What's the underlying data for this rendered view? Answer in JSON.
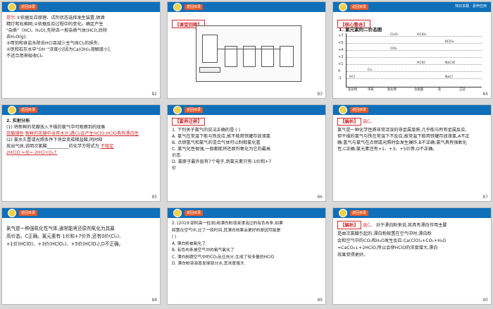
{
  "common": {
    "back_label": "返回目录",
    "tagline": "知识关联 · 素养应用"
  },
  "slides": [
    {
      "page": "82",
      "hint_label": "提示:",
      "lines": [
        "①依据反应原理、试剂状态选择发生装置,钠酒",
        "精灯和石棉网;②依据反应过程中的变化。确定产生",
        "\"杂质\"（HCl、H₂O),先除去一般杂质气体(HCl),后除",
        "去H₂O(g);",
        "③用饱和食盐水除去HCl且减少主气体Cl₂的损失;",
        "④饱和石灰水中\"OH⁻\"浓度小[因为Ca(OH)₂溶解度小],",
        "不适合用来吸收Cl₂"
      ]
    },
    {
      "page": "83",
      "box_title": "【课堂回眸】"
    },
    {
      "page": "84",
      "box_title": "【核心整合】",
      "heading": "1. 氯元素的二价态图",
      "y_ticks": [
        "+7",
        "+5",
        "+4",
        "+3",
        "+1",
        "0",
        "-1"
      ],
      "x_ticks": [
        "氢化物",
        "单质",
        "氧化物",
        "含氧酸",
        "盐",
        "正盐"
      ],
      "cells": [
        "Cl₂O₇",
        "HClO₄",
        "ClO₂",
        "KClO₃",
        "HClO",
        "NaClO",
        "Cl₂",
        "HCl",
        "NaCl"
      ]
    },
    {
      "page": "85",
      "lines": [
        "2. 实射分析",
        "(1) 将新鲜的花瓣放入干燥的氯气中可观察到的现象",
        "是__________,原因是__________",
        "(2) 氯水久置或光照条件下将会变成稀盐酸,同时释",
        "放出气体,说明次氯酸__________的化学方程式为",
        "__________"
      ],
      "answer_1": "花瓣褪色",
      "answer_2": "新鲜的花瓣中含有水分,遇Cl₂会产生HClO,HClO具有漂白性",
      "answer_3": "不稳定",
      "answer_4": "2HClO =光= 2HCl+O₂↑"
    },
    {
      "page": "86",
      "box_title": "【素养迁移】",
      "lines": [
        "1. 下列关于氯气的说法正确的是 (      )",
        "A. 氯气在常温下能与铁反应,故不能用铁罐存放液氯",
        "B. 点燃氢气和氯气的混合气体可以制取氯化氢",
        "C. 氯气化性很强,一般都能将还原剂氧化为它的最高",
        "价态",
        "D. 氯原子最外层有7个电子,到氯元素只有-1价和+7",
        "价"
      ]
    },
    {
      "page": "87",
      "box_title": "【解析】",
      "answer": "选C。",
      "lines": [
        "氯气是一种化学性质非常活泼的非金属单质,几乎能与所有金属反应,",
        "但干燥的氯气与铁在常温下不反应,故常温下能用铁罐存放液氯,A不正",
        "确;氢气与氯气在点燃或光照时会发生爆炸,B不正确;氯气具有强氧化",
        "性,C正确;氯元素还有+1、+3、+5价等,D不正确。"
      ]
    },
    {
      "page": "88",
      "lines": [
        "氯气是一种强氧化性气体,通常能将还原剂氧化为其最",
        "高价态。C正确。氯元素有-1价和+7价外,还有0价(Cl₂)、",
        "+1价(HClO)、+3价(HClO₂)、+5价(HClO₃),D不正确。"
      ]
    },
    {
      "page": "89",
      "lines": [
        "2. (2019·邵阳高一检测)用漂白粉溶液浸泡过的有色布条,如果",
        "晾置在空气中,过了一段时间,其漂白效果会更好的原因可能是",
        "(      )",
        "A. 漂白粉被氧化了",
        "B. 有色布条被空气中的氧气氧化了",
        "C. 漂白粉跟空气中的CO₂反应充分,生成了较多量的HClO",
        "D. 漂白粉溶液蒸发掉部分水,其浓度增大"
      ]
    },
    {
      "page": "90",
      "box_title": "【解析】",
      "answer": "选C。",
      "lines": [
        "对于漂白粉来说,其具有漂白作用主要",
        "是由次氯酸引起的,漂白粉敞置在空气中时,漂白粉",
        "会和空气中的CO₂和H₂O发生反应:Ca(ClO)₂+CO₂+H₂O",
        "=CaCO₃↓+2HClO,所以会使HClO的浓度增大,漂白",
        "效果变得更好。"
      ]
    }
  ]
}
